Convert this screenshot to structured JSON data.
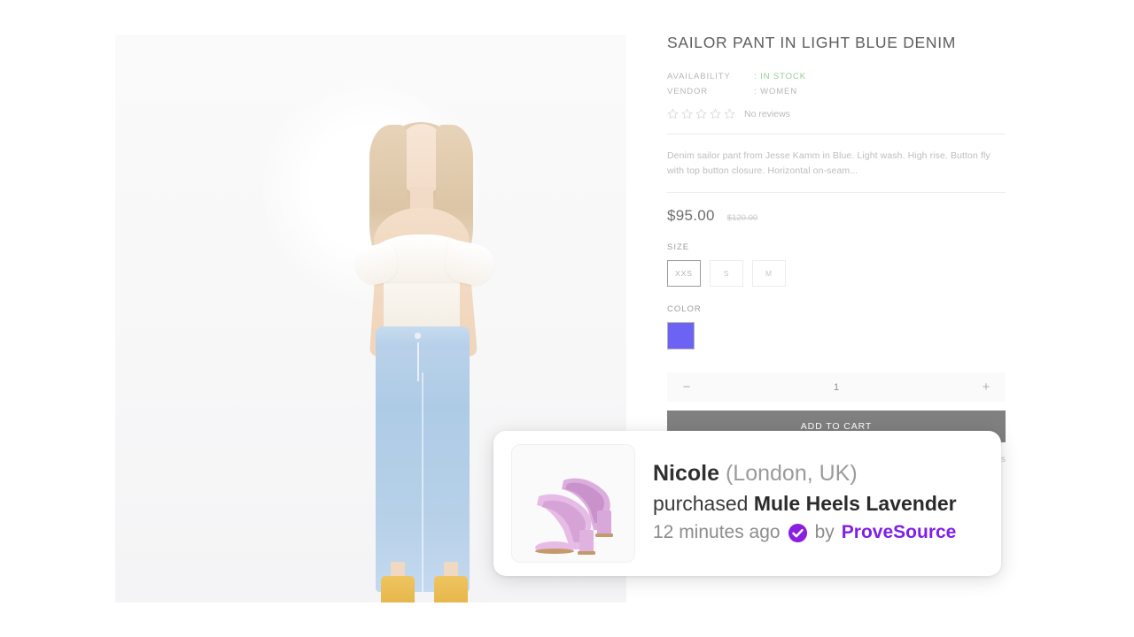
{
  "product": {
    "title": "SAILOR PANT IN LIGHT BLUE DENIM",
    "meta": [
      {
        "label": "AVAILABILITY",
        "value": ": IN STOCK",
        "status": "in-stock"
      },
      {
        "label": "VENDOR",
        "value": ": WOMEN",
        "status": "normal"
      }
    ],
    "rating": {
      "stars_total": 5,
      "stars_filled": 0,
      "reviews_text": "No reviews"
    },
    "description": "Denim sailor pant from Jesse Kamm in Blue. Light wash. High rise. Button fly with top button closure. Horizontal on-seam...",
    "price_current": "$95.00",
    "price_old": "$120.00",
    "size": {
      "label": "SIZE",
      "options": [
        {
          "label": "XXS",
          "selected": true
        },
        {
          "label": "S",
          "selected": false
        },
        {
          "label": "M",
          "selected": false
        }
      ]
    },
    "color": {
      "label": "COLOR",
      "options": [
        {
          "name": "periwinkle-blue",
          "hex": "#6C63F5",
          "selected": true
        }
      ]
    },
    "quantity": {
      "decrement_label": "−",
      "value": "1",
      "increment_label": "+"
    },
    "add_to_cart_label": "ADD TO CART",
    "below_cart_text": "s"
  },
  "notification": {
    "person_name": "Nicole",
    "person_location": "(London, UK)",
    "action_verb": "purchased",
    "product_name": "Mule Heels Lavender",
    "timestamp": "12 minutes ago",
    "by_label": "by",
    "brand": "ProveSource",
    "brand_color": "#7F1FE8",
    "thumbnail_alt": "lavender-mule-heels"
  },
  "colors": {
    "in_stock_green": "#93CC93",
    "add_to_cart_gray": "#808080",
    "gallery_background": "#F8F8F9"
  }
}
